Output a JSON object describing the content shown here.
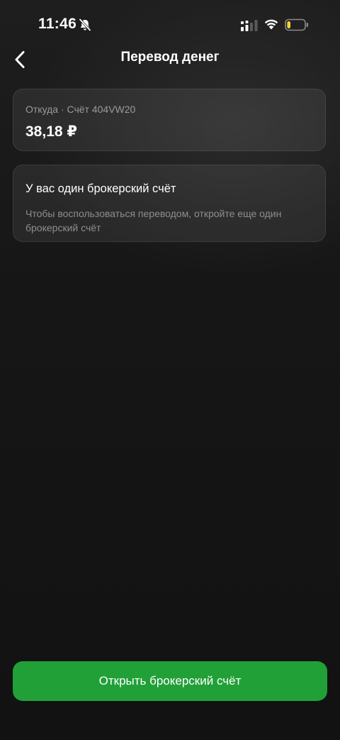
{
  "status_bar": {
    "time": "11:46",
    "icons": [
      "bell-slash-icon",
      "cellular-signal-icon",
      "wifi-icon",
      "battery-icon"
    ],
    "battery_level": 0.2,
    "battery_color": "#f2d33b"
  },
  "nav": {
    "back_icon": "chevron-left-icon",
    "title": "Перевод денег"
  },
  "from_card": {
    "label": "Откуда · Счёт 404VW20",
    "amount": "38,18 ₽"
  },
  "notice_card": {
    "title": "У вас один брокерский счёт",
    "text": "Чтобы воспользоваться переводом, откройте еще один брокерский счёт"
  },
  "primary_button": {
    "label": "Открыть брокерский счёт",
    "color": "#21a038"
  },
  "colors": {
    "background": "#141414",
    "card": "#262626",
    "secondary_text": "#9a9a9a"
  }
}
